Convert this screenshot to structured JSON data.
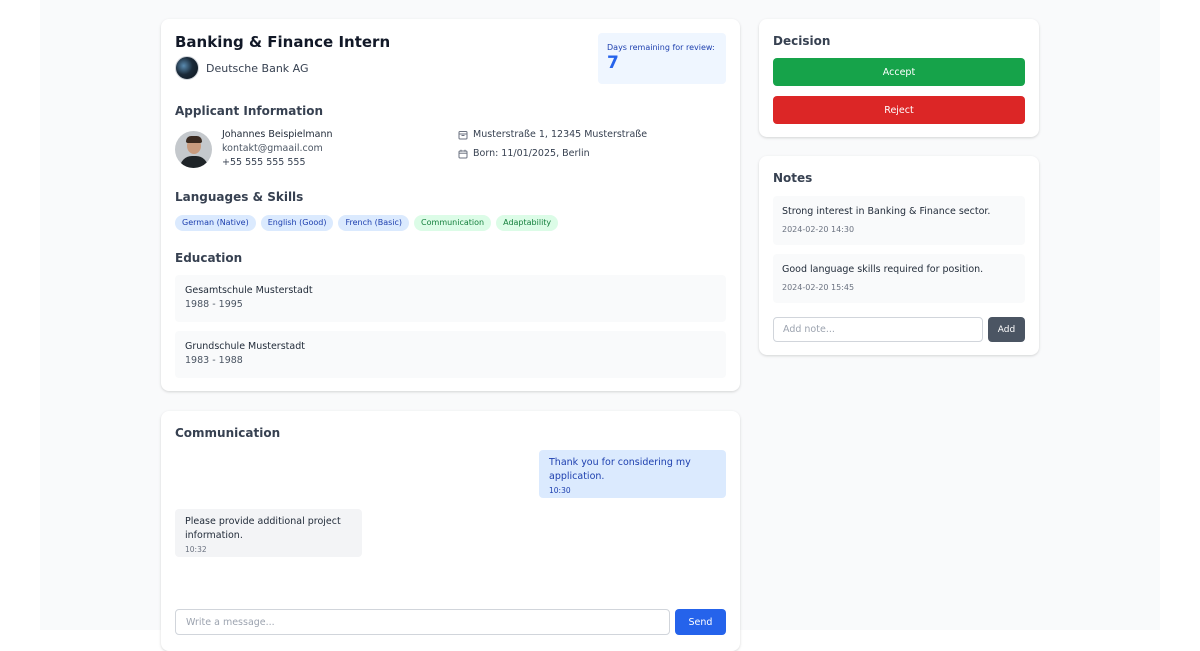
{
  "job": {
    "title": "Banking & Finance Intern",
    "company": "Deutsche Bank AG",
    "days_label": "Days remaining for review:",
    "days_value": "7"
  },
  "applicant": {
    "section_title": "Applicant Information",
    "name": "Johannes Beispielmann",
    "email": "kontakt@gmaail.com",
    "phone": "+55 555 555 555",
    "address": "Musterstraße 1, 12345 Musterstraße",
    "born": "Born: 11/01/2025, Berlin"
  },
  "skills": {
    "section_title": "Languages & Skills",
    "languages": [
      "German (Native)",
      "English (Good)",
      "French (Basic)"
    ],
    "soft_skills": [
      "Communication",
      "Adaptability"
    ]
  },
  "education": {
    "section_title": "Education",
    "items": [
      {
        "school": "Gesamtschule Musterstadt",
        "years": "1988 - 1995"
      },
      {
        "school": "Grundschule Musterstadt",
        "years": "1983 - 1988"
      }
    ]
  },
  "communication": {
    "section_title": "Communication",
    "messages": [
      {
        "text": "Thank you for considering my application.",
        "time": "10:30",
        "direction": "outgoing"
      },
      {
        "text": "Please provide additional project information.",
        "time": "10:32",
        "direction": "incoming"
      }
    ],
    "input_placeholder": "Write a message...",
    "send_label": "Send"
  },
  "decision": {
    "title": "Decision",
    "accept_label": "Accept",
    "reject_label": "Reject"
  },
  "notes": {
    "title": "Notes",
    "items": [
      {
        "text": "Strong interest in Banking & Finance sector.",
        "time": "2024-02-20 14:30"
      },
      {
        "text": "Good language skills required for position.",
        "time": "2024-02-20 15:45"
      }
    ],
    "input_placeholder": "Add note...",
    "add_label": "Add"
  },
  "colors": {
    "accept": "#16a34a",
    "reject": "#dc2626",
    "primary": "#2563eb",
    "note_add": "#4b5563"
  },
  "icons": {
    "address": "building-icon",
    "born": "calendar-icon",
    "company_logo": "company-logo"
  }
}
